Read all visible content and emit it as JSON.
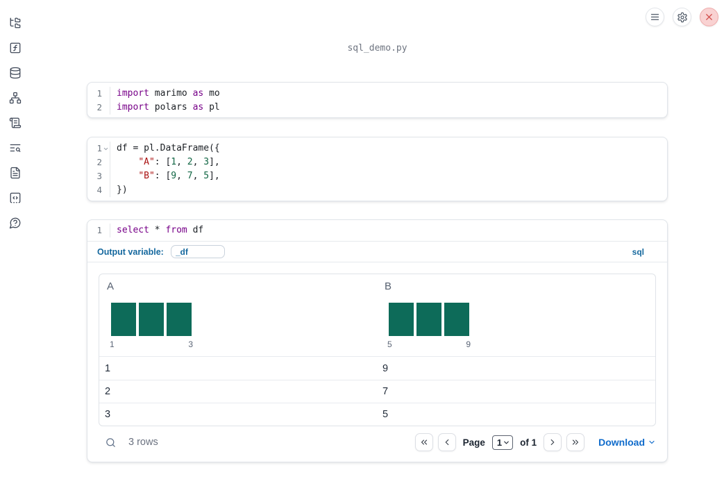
{
  "window": {
    "title": "sql_demo.py"
  },
  "colors": {
    "keyword": "#770088",
    "string": "#aa1111",
    "number": "#116644",
    "accent_blue": "#15689e",
    "link_blue": "#0f6bcb",
    "histogram_bar": "#0d6b59",
    "muted_text": "#64748b",
    "close_red": "#d2504e",
    "close_bg": "#f9d2d2",
    "sidebar_icon": "#3d4656",
    "card_border": "#e0e4e9"
  },
  "sidebar": {
    "items": [
      {
        "icon": "folder-tree"
      },
      {
        "icon": "function-square"
      },
      {
        "icon": "database"
      },
      {
        "icon": "network"
      },
      {
        "icon": "scroll-text"
      },
      {
        "icon": "text-search"
      },
      {
        "icon": "file-text"
      },
      {
        "icon": "square-code"
      },
      {
        "icon": "help-bubble"
      }
    ]
  },
  "topbar": {
    "buttons": [
      {
        "icon": "menu"
      },
      {
        "icon": "settings"
      },
      {
        "icon": "close"
      }
    ]
  },
  "cells": [
    {
      "lines": [
        {
          "num": "1",
          "tokens": [
            {
              "t": "import"
            },
            {
              "t": " marimo "
            },
            {
              "t": "as"
            },
            {
              "t": " mo"
            }
          ]
        },
        {
          "num": "2",
          "tokens": [
            {
              "t": "import"
            },
            {
              "t": " polars "
            },
            {
              "t": "as"
            },
            {
              "t": " pl"
            }
          ]
        }
      ]
    },
    {
      "lines": [
        {
          "num": "1",
          "foldable": true,
          "tokens": [
            {
              "t": "df = pl.DataFrame({"
            }
          ]
        },
        {
          "num": "2",
          "tokens": [
            {
              "t": "    "
            },
            {
              "t": "\"A\""
            },
            {
              "t": ": ["
            },
            {
              "t": "1"
            },
            {
              "t": ", "
            },
            {
              "t": "2"
            },
            {
              "t": ", "
            },
            {
              "t": "3"
            },
            {
              "t": "],"
            }
          ]
        },
        {
          "num": "3",
          "tokens": [
            {
              "t": "    "
            },
            {
              "t": "\"B\""
            },
            {
              "t": ": ["
            },
            {
              "t": "9"
            },
            {
              "t": ", "
            },
            {
              "t": "7"
            },
            {
              "t": ", "
            },
            {
              "t": "5"
            },
            {
              "t": "],"
            }
          ]
        },
        {
          "num": "4",
          "tokens": [
            {
              "t": "})"
            }
          ]
        }
      ]
    },
    {
      "lines": [
        {
          "num": "1",
          "tokens": [
            {
              "t": "select"
            },
            {
              "t": " * "
            },
            {
              "t": "from"
            },
            {
              "t": " df"
            }
          ]
        }
      ]
    }
  ],
  "sql_cell": {
    "output_variable_label": "Output variable:",
    "output_variable_value": "_df",
    "language_label": "sql"
  },
  "output_table": {
    "columns": [
      {
        "name": "A",
        "histogram": {
          "type": "bar",
          "bars": [
            1,
            1,
            1
          ],
          "min_label": "1",
          "max_label": "3"
        }
      },
      {
        "name": "B",
        "histogram": {
          "type": "bar",
          "bars": [
            1,
            1,
            1
          ],
          "min_label": "5",
          "max_label": "9"
        }
      }
    ],
    "rows": [
      [
        "1",
        "9"
      ],
      [
        "2",
        "7"
      ],
      [
        "3",
        "5"
      ]
    ],
    "footer": {
      "row_count": "3 rows",
      "page_label": "Page",
      "page_value": "1",
      "of_label": "of 1",
      "download_label": "Download"
    }
  }
}
